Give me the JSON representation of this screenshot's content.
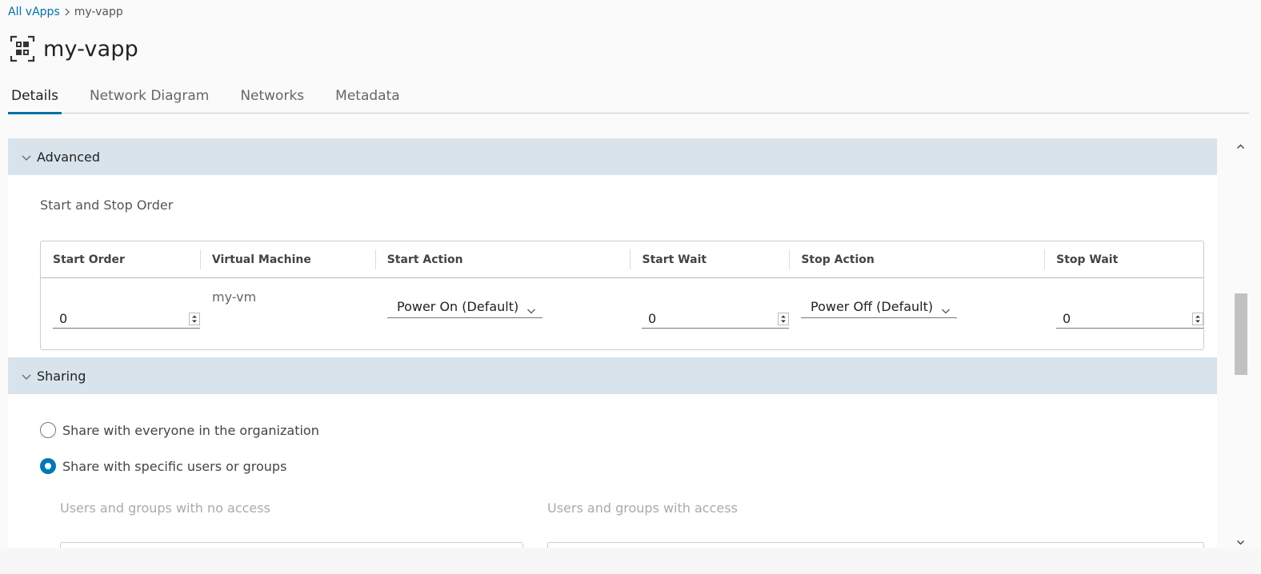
{
  "breadcrumb": {
    "parent": "All vApps",
    "current": "my-vapp"
  },
  "title": "my-vapp",
  "tabs": [
    {
      "label": "Details",
      "active": true
    },
    {
      "label": "Network Diagram",
      "active": false
    },
    {
      "label": "Networks",
      "active": false
    },
    {
      "label": "Metadata",
      "active": false
    }
  ],
  "advanced": {
    "header": "Advanced",
    "subtitle": "Start and Stop Order",
    "columns": [
      "Start Order",
      "Virtual Machine",
      "Start Action",
      "Start Wait",
      "Stop Action",
      "Stop Wait"
    ],
    "rows": [
      {
        "start_order": "0",
        "vm": "my-vm",
        "start_action": "Power On (Default)",
        "start_wait": "0",
        "stop_action": "Power Off (Default)",
        "stop_wait": "0"
      }
    ]
  },
  "sharing": {
    "header": "Sharing",
    "option_everyone": "Share with everyone in the organization",
    "option_specific": "Share with specific users or groups",
    "selected": "specific",
    "no_access_label": "Users and groups with no access",
    "access_label": "Users and groups with access"
  },
  "colors": {
    "accent": "#0072a3",
    "section_bg": "#d8e3eb",
    "radio_checked": "#0079b8"
  }
}
